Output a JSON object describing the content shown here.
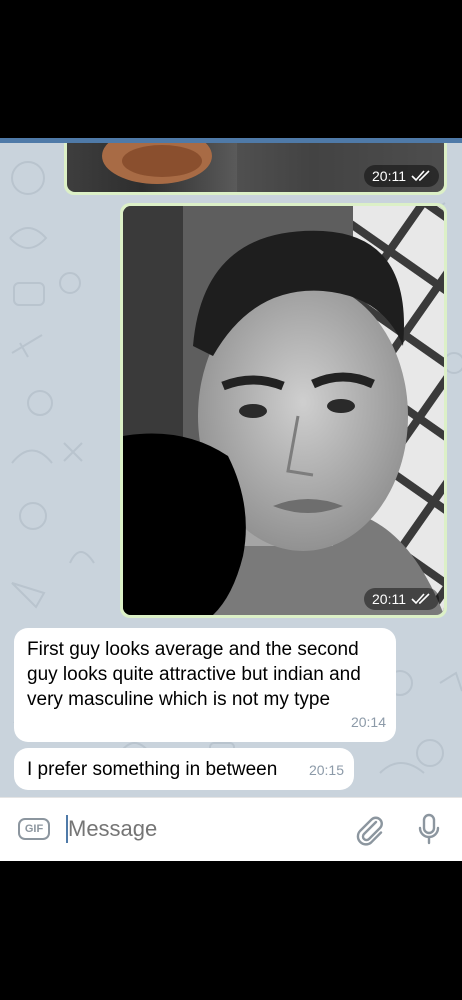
{
  "messages": {
    "image1": {
      "time": "20:11",
      "status_icon": "double-check-icon"
    },
    "image2": {
      "time": "20:11",
      "status_icon": "double-check-icon"
    },
    "text1": {
      "text": "First guy looks average and the second guy looks quite attractive but indian and very masculine which is not my type",
      "time": "20:14"
    },
    "text2": {
      "text": "I prefer something in between",
      "time": "20:15"
    }
  },
  "composer": {
    "gif_label": "GIF",
    "placeholder": "Message",
    "attach_icon": "paperclip-icon",
    "mic_icon": "microphone-icon"
  },
  "colors": {
    "accent": "#4f7aa8",
    "outgoing_bubble": "#dcf0c7",
    "chat_background": "#c9d3dc"
  }
}
